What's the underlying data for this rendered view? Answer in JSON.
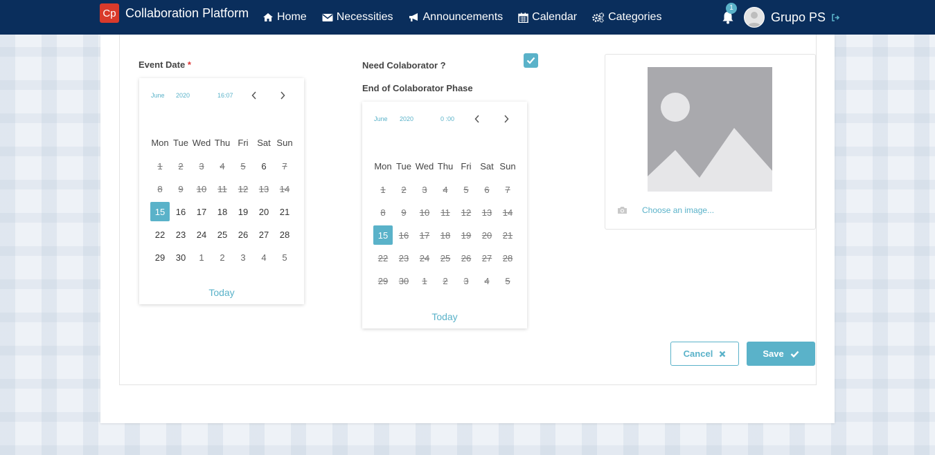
{
  "navbar": {
    "logo_text": "Cp",
    "app_name": "Collaboration Platform",
    "items": [
      {
        "label": "Home",
        "icon": "home-icon"
      },
      {
        "label": "Necessities",
        "icon": "envelope-icon"
      },
      {
        "label": "Announcements",
        "icon": "bullhorn-icon"
      },
      {
        "label": "Calendar",
        "icon": "calendar-icon"
      },
      {
        "label": "Categories",
        "icon": "gears-icon"
      }
    ],
    "notification_count": "1",
    "user_name": "Grupo PS"
  },
  "form": {
    "event_date_label": "Event Date",
    "required_mark": "*",
    "need_collaborator_label": "Need Colaborator ?",
    "need_collaborator_checked": true,
    "end_phase_label": "End of Colaborator Phase",
    "choose_image_label": "Choose an image...",
    "cancel_label": "Cancel",
    "save_label": "Save"
  },
  "event_calendar": {
    "month": "June",
    "year": "2020",
    "time": "16:07",
    "weekdays": [
      "Mon",
      "Tue",
      "Wed",
      "Thu",
      "Fri",
      "Sat",
      "Sun"
    ],
    "days": [
      {
        "d": "1",
        "s": "dis"
      },
      {
        "d": "2",
        "s": "dis"
      },
      {
        "d": "3",
        "s": "dis"
      },
      {
        "d": "4",
        "s": "dis"
      },
      {
        "d": "5",
        "s": "dis"
      },
      {
        "d": "6",
        "s": ""
      },
      {
        "d": "7",
        "s": "dis"
      },
      {
        "d": "8",
        "s": "dis"
      },
      {
        "d": "9",
        "s": "dis"
      },
      {
        "d": "10",
        "s": "dis"
      },
      {
        "d": "11",
        "s": "dis"
      },
      {
        "d": "12",
        "s": "dis"
      },
      {
        "d": "13",
        "s": "dis"
      },
      {
        "d": "14",
        "s": "dis"
      },
      {
        "d": "15",
        "s": "sel"
      },
      {
        "d": "16",
        "s": ""
      },
      {
        "d": "17",
        "s": ""
      },
      {
        "d": "18",
        "s": ""
      },
      {
        "d": "19",
        "s": ""
      },
      {
        "d": "20",
        "s": ""
      },
      {
        "d": "21",
        "s": ""
      },
      {
        "d": "22",
        "s": ""
      },
      {
        "d": "23",
        "s": ""
      },
      {
        "d": "24",
        "s": ""
      },
      {
        "d": "25",
        "s": ""
      },
      {
        "d": "26",
        "s": ""
      },
      {
        "d": "27",
        "s": ""
      },
      {
        "d": "28",
        "s": ""
      },
      {
        "d": "29",
        "s": ""
      },
      {
        "d": "30",
        "s": ""
      },
      {
        "d": "1",
        "s": "other"
      },
      {
        "d": "2",
        "s": "other"
      },
      {
        "d": "3",
        "s": "other"
      },
      {
        "d": "4",
        "s": "other"
      },
      {
        "d": "5",
        "s": "other"
      }
    ],
    "today_label": "Today"
  },
  "phase_calendar": {
    "month": "June",
    "year": "2020",
    "time": "0 :00",
    "weekdays": [
      "Mon",
      "Tue",
      "Wed",
      "Thu",
      "Fri",
      "Sat",
      "Sun"
    ],
    "days": [
      {
        "d": "1",
        "s": "dis"
      },
      {
        "d": "2",
        "s": "dis"
      },
      {
        "d": "3",
        "s": "dis"
      },
      {
        "d": "4",
        "s": "dis"
      },
      {
        "d": "5",
        "s": "dis"
      },
      {
        "d": "6",
        "s": "dis"
      },
      {
        "d": "7",
        "s": "dis"
      },
      {
        "d": "8",
        "s": "dis"
      },
      {
        "d": "9",
        "s": "dis"
      },
      {
        "d": "10",
        "s": "dis"
      },
      {
        "d": "11",
        "s": "dis"
      },
      {
        "d": "12",
        "s": "dis"
      },
      {
        "d": "13",
        "s": "dis"
      },
      {
        "d": "14",
        "s": "dis"
      },
      {
        "d": "15",
        "s": "sel"
      },
      {
        "d": "16",
        "s": "dis"
      },
      {
        "d": "17",
        "s": "dis"
      },
      {
        "d": "18",
        "s": "dis"
      },
      {
        "d": "19",
        "s": "dis"
      },
      {
        "d": "20",
        "s": "dis"
      },
      {
        "d": "21",
        "s": "dis"
      },
      {
        "d": "22",
        "s": "dis"
      },
      {
        "d": "23",
        "s": "dis"
      },
      {
        "d": "24",
        "s": "dis"
      },
      {
        "d": "25",
        "s": "dis"
      },
      {
        "d": "26",
        "s": "dis"
      },
      {
        "d": "27",
        "s": "dis"
      },
      {
        "d": "28",
        "s": "dis"
      },
      {
        "d": "29",
        "s": "dis"
      },
      {
        "d": "30",
        "s": "dis"
      },
      {
        "d": "1",
        "s": "dis"
      },
      {
        "d": "2",
        "s": "dis"
      },
      {
        "d": "3",
        "s": "dis"
      },
      {
        "d": "4",
        "s": "dis"
      },
      {
        "d": "5",
        "s": "dis"
      }
    ],
    "today_label": "Today"
  },
  "colors": {
    "navbar": "#0a2e5c",
    "accent": "#5ab2c9",
    "logo": "#d93a2b"
  }
}
